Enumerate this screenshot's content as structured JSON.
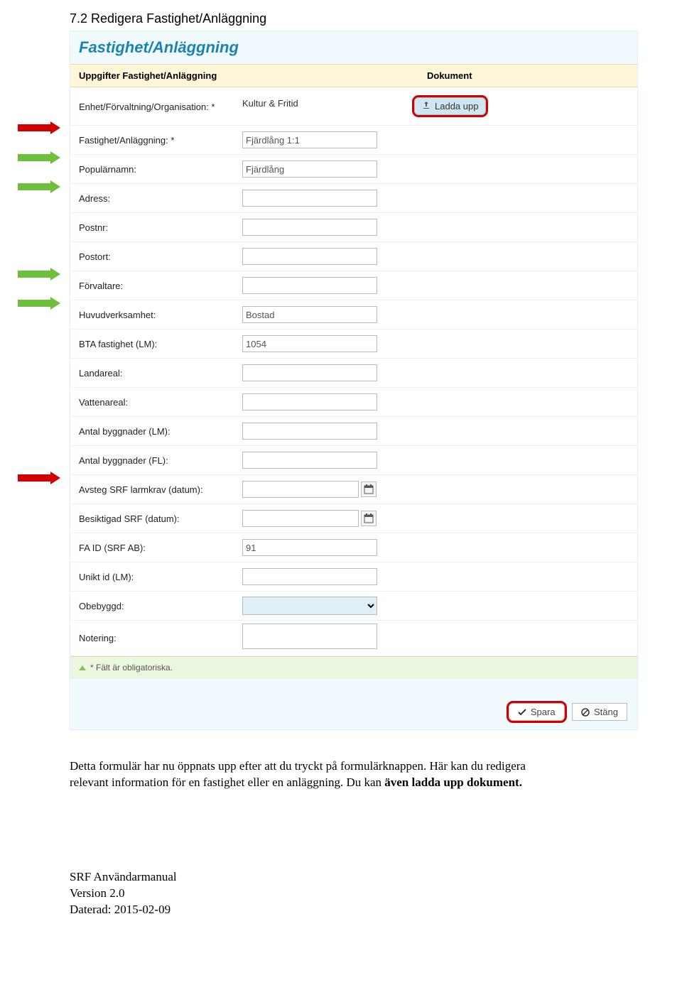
{
  "section": {
    "num_title": "7.2   Redigera Fastighet/Anläggning"
  },
  "panel": {
    "title": "Fastighet/Anläggning",
    "col_left": "Uppgifter Fastighet/Anläggning",
    "col_right": "Dokument"
  },
  "upload": {
    "label": "Ladda upp"
  },
  "fields": {
    "enhet_lbl": "Enhet/Förvaltning/Organisation: *",
    "enhet_val": "Kultur & Fritid",
    "fastighet_lbl": "Fastighet/Anläggning: *",
    "fastighet_val": "Fjärdlång 1:1",
    "popnamn_lbl": "Populärnamn:",
    "popnamn_val": "Fjärdlång",
    "adress_lbl": "Adress:",
    "adress_val": "",
    "postnr_lbl": "Postnr:",
    "postnr_val": "",
    "postort_lbl": "Postort:",
    "postort_val": "",
    "forvaltare_lbl": "Förvaltare:",
    "forvaltare_val": "",
    "huvudverk_lbl": "Huvudverksamhet:",
    "huvudverk_val": "Bostad",
    "bta_lbl": "BTA fastighet (LM):",
    "bta_val": "1054",
    "landareal_lbl": "Landareal:",
    "landareal_val": "",
    "vattenareal_lbl": "Vattenareal:",
    "vattenareal_val": "",
    "antbygg_lm_lbl": "Antal byggnader (LM):",
    "antbygg_lm_val": "",
    "antbygg_fl_lbl": "Antal byggnader (FL):",
    "antbygg_fl_val": "",
    "avsteg_lbl": "Avsteg SRF larmkrav (datum):",
    "avsteg_val": "",
    "besiktigad_lbl": "Besiktigad SRF (datum):",
    "besiktigad_val": "",
    "faid_lbl": "FA ID (SRF AB):",
    "faid_val": "91",
    "unikt_lbl": "Unikt id (LM):",
    "unikt_val": "",
    "obebyggd_lbl": "Obebyggd:",
    "obebyggd_val": "",
    "notering_lbl": "Notering:",
    "notering_val": ""
  },
  "footer_hint": "* Fält är obligatoriska.",
  "buttons": {
    "save": "Spara",
    "close": "Stäng"
  },
  "paragraph": {
    "t1": "Detta formulär har nu öppnats upp efter att du tryckt på formulärknappen. Här kan du redigera relevant information för en fastighet eller en anläggning. Du kan ",
    "bold": "även ladda upp dokument.",
    "t2": ""
  },
  "docfooter": {
    "l1": "SRF Användarmanual",
    "l2": "Version 2.0",
    "l3": "Daterad: 2015-02-09"
  }
}
